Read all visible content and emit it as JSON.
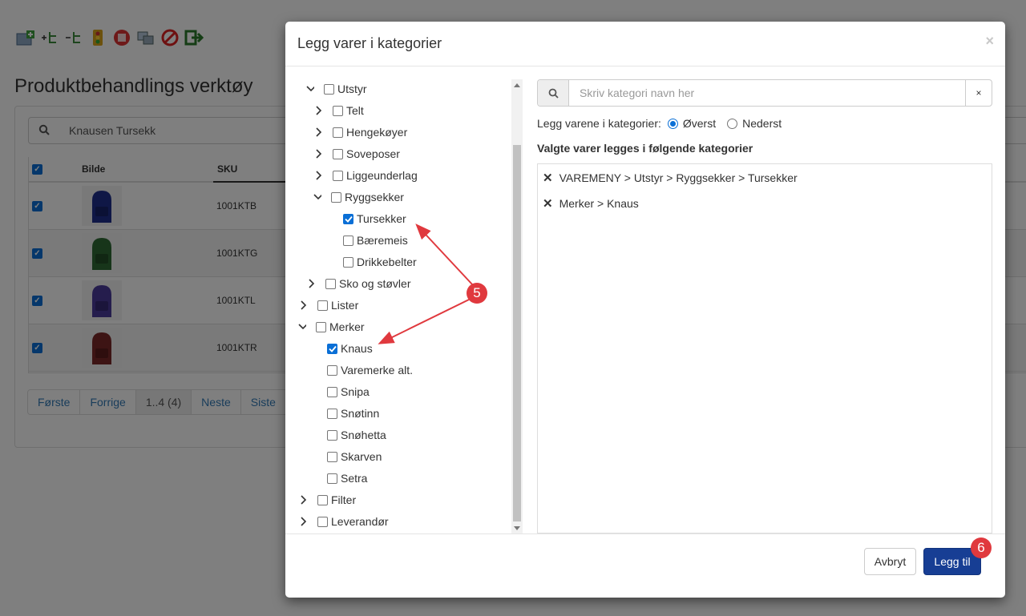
{
  "background": {
    "page_title": "Produktbehandlings verktøy",
    "search_value": "Knausen Tursekk",
    "toolbar_icons": [
      "add-category-icon",
      "add-node-icon",
      "remove-node-icon",
      "traffic-light-icon",
      "stop-icon",
      "copy-icon",
      "forbidden-icon",
      "exit-icon"
    ],
    "table": {
      "headers": {
        "image": "Bilde",
        "sku": "SKU"
      },
      "rows": [
        {
          "sku": "1001KTB",
          "color": "#1f2f8c"
        },
        {
          "sku": "1001KTG",
          "color": "#2e6b34"
        },
        {
          "sku": "1001KTL",
          "color": "#4a3a9a"
        },
        {
          "sku": "1001KTR",
          "color": "#7a2828"
        }
      ]
    },
    "pager": [
      "Første",
      "Forrige",
      "1..4 (4)",
      "Neste",
      "Siste"
    ]
  },
  "modal": {
    "title": "Legg varer i kategorier",
    "close": "×",
    "tree": [
      {
        "label": "Utstyr",
        "expanded": true,
        "checked": false
      },
      {
        "label": "Telt",
        "expanded": false,
        "checked": false
      },
      {
        "label": "Hengekøyer",
        "expanded": false,
        "checked": false
      },
      {
        "label": "Soveposer",
        "expanded": false,
        "checked": false
      },
      {
        "label": "Liggeunderlag",
        "expanded": false,
        "checked": false
      },
      {
        "label": "Ryggsekker",
        "expanded": true,
        "checked": false
      },
      {
        "label": "Tursekker",
        "checked": true
      },
      {
        "label": "Bæremeis",
        "checked": false
      },
      {
        "label": "Drikkebelter",
        "checked": false
      },
      {
        "label": "Sko og støvler",
        "expanded": false,
        "checked": false
      },
      {
        "label": "Lister",
        "expanded": false,
        "checked": false
      },
      {
        "label": "Merker",
        "expanded": true,
        "checked": false
      },
      {
        "label": "Knaus",
        "checked": true
      },
      {
        "label": "Varemerke alt.",
        "checked": false
      },
      {
        "label": "Snipa",
        "checked": false
      },
      {
        "label": "Snøtinn",
        "checked": false
      },
      {
        "label": "Snøhetta",
        "checked": false
      },
      {
        "label": "Skarven",
        "checked": false
      },
      {
        "label": "Setra",
        "checked": false
      },
      {
        "label": "Filter",
        "expanded": false,
        "checked": false
      },
      {
        "label": "Leverandør",
        "expanded": false,
        "checked": false
      }
    ],
    "search": {
      "placeholder": "Skriv kategori navn her",
      "clear": "×"
    },
    "placement": {
      "label": "Legg varene i kategorier:",
      "options": [
        "Øverst",
        "Nederst"
      ],
      "selected": "Øverst"
    },
    "selected_heading": "Valgte varer legges i følgende kategorier",
    "selected_items": [
      "VAREMENY > Utstyr > Ryggsekker > Tursekker",
      "Merker > Knaus"
    ],
    "buttons": {
      "cancel": "Avbryt",
      "add": "Legg til"
    },
    "callouts": [
      "5",
      "6"
    ]
  },
  "colors": {
    "primary_button": "#173e94",
    "checkbox": "#0a6fd6",
    "callout": "#e0393e"
  }
}
